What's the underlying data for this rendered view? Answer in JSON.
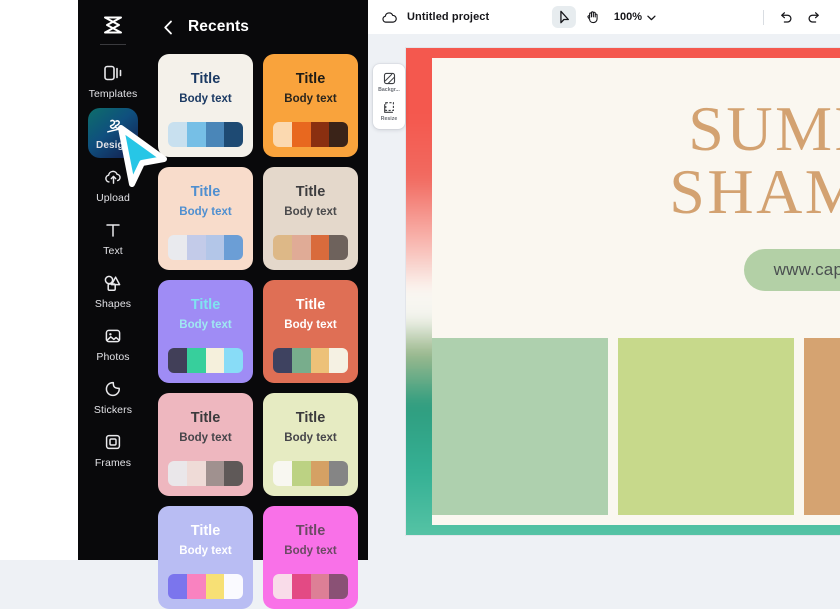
{
  "app": {
    "logo_icon": "capcut-logo-icon"
  },
  "rail": {
    "items": [
      {
        "label": "Templates",
        "icon": "templates-icon",
        "active": false
      },
      {
        "label": "Design",
        "icon": "design-icon",
        "active": true
      },
      {
        "label": "Upload",
        "icon": "upload-cloud-icon",
        "active": false
      },
      {
        "label": "Text",
        "icon": "text-icon",
        "active": false
      },
      {
        "label": "Shapes",
        "icon": "shapes-icon",
        "active": false
      },
      {
        "label": "Photos",
        "icon": "photos-icon",
        "active": false
      },
      {
        "label": "Stickers",
        "icon": "stickers-icon",
        "active": false
      },
      {
        "label": "Frames",
        "icon": "frames-icon",
        "active": false
      }
    ]
  },
  "panel": {
    "title": "Recents",
    "back_icon": "chevron-left-icon",
    "cards": [
      {
        "title": "Title",
        "body": "Body text",
        "bg": "#f4f1ea",
        "title_color": "#1b3a63",
        "body_color": "#1b3a63",
        "swatches": [
          "#c8e0ef",
          "#76bfe6",
          "#4a86b8",
          "#1e4a73"
        ]
      },
      {
        "title": "Title",
        "body": "Body text",
        "bg": "#f9a33c",
        "title_color": "#1e1b16",
        "body_color": "#2a251d",
        "swatches": [
          "#fbd9b0",
          "#e8681f",
          "#8a2f10",
          "#3a2318"
        ]
      },
      {
        "title": "Title",
        "body": "Body text",
        "bg": "#f8dccb",
        "title_color": "#4f8fd0",
        "body_color": "#4f8fd0",
        "swatches": [
          "#e9eaee",
          "#c3cbe9",
          "#b3c6e8",
          "#6b9ed6"
        ]
      },
      {
        "title": "Title",
        "body": "Body text",
        "bg": "#e4d8cb",
        "title_color": "#3d3d3f",
        "body_color": "#4a4a4c",
        "swatches": [
          "#ddb887",
          "#e0ab96",
          "#d96b3c",
          "#6e625c"
        ]
      },
      {
        "title": "Title",
        "body": "Body text",
        "bg": "#9f8cf5",
        "title_color": "#7fe3f0",
        "body_color": "#9fe8f2",
        "swatches": [
          "#413f58",
          "#37cf9c",
          "#f5f0dc",
          "#88dcf7"
        ]
      },
      {
        "title": "Title",
        "body": "Body text",
        "bg": "#df6f55",
        "title_color": "#ffffff",
        "body_color": "#ffffff",
        "swatches": [
          "#3e4260",
          "#78ad8c",
          "#edc178",
          "#f5f1e3"
        ]
      },
      {
        "title": "Title",
        "body": "Body text",
        "bg": "#eeb7bf",
        "title_color": "#3b3a3c",
        "body_color": "#46454a",
        "swatches": [
          "#eae7ea",
          "#efdbd7",
          "#a0918f",
          "#5f5958"
        ]
      },
      {
        "title": "Title",
        "body": "Body text",
        "bg": "#e6ebc2",
        "title_color": "#3b3a3c",
        "body_color": "#46454a",
        "swatches": [
          "#f8f7f1",
          "#bcd283",
          "#d5a164",
          "#858585"
        ]
      },
      {
        "title": "Title",
        "body": "Body text",
        "bg": "#b9bdf3",
        "title_color": "#ffffff",
        "body_color": "#ffffff",
        "swatches": [
          "#7b75ed",
          "#f982c0",
          "#f7e075",
          "#fafaff"
        ]
      },
      {
        "title": "Title",
        "body": "Body text",
        "bg": "#f971e8",
        "title_color": "#6a4a63",
        "body_color": "#6a4a63",
        "swatches": [
          "#f9dce9",
          "#e34a84",
          "#dd7f96",
          "#8a5175"
        ]
      }
    ]
  },
  "topbar": {
    "cloud_icon": "cloud-save-icon",
    "project_name": "Untitled project",
    "select_tool_icon": "cursor-select-icon",
    "hand_tool_icon": "hand-pan-icon",
    "zoom_value": "100%",
    "zoom_chevron_icon": "chevron-down-icon",
    "undo_icon": "undo-icon",
    "redo_icon": "redo-icon"
  },
  "float_tools": {
    "items": [
      {
        "label": "Backgr...",
        "icon": "background-icon"
      },
      {
        "label": "Resize",
        "icon": "resize-icon"
      }
    ]
  },
  "canvas": {
    "title_line_1": "SUMMER",
    "title_line_2": "SHAMPOO",
    "title_color": "#d3a271",
    "pill_text": "www.caput.com",
    "pill_bg": "#b3d0a6",
    "pill_text_color": "#4a4f50",
    "blocks": [
      {
        "color": "#aed0ae"
      },
      {
        "color": "#c7d98b"
      },
      {
        "color": "#d5a371"
      }
    ]
  },
  "cursor": {
    "icon": "mouse-pointer-cursor",
    "color": "#27c6e6"
  }
}
